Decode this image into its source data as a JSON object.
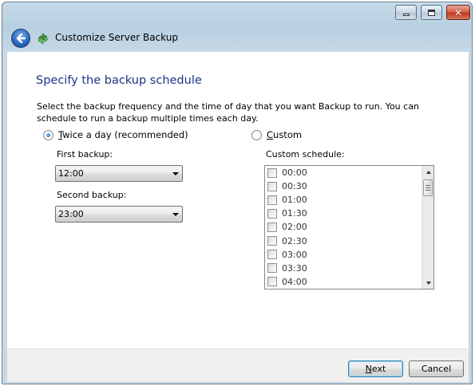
{
  "window": {
    "title": "Customize Server Backup",
    "controls": {
      "minimize_icon": "minimize-icon",
      "maximize_icon": "maximize-icon",
      "close_icon": "close-icon",
      "close_glyph": "✕"
    }
  },
  "page": {
    "heading": "Specify the backup schedule",
    "instructions": "Select the backup frequency and the time of day that you want Backup to run. You can schedule to run a backup multiple times each day."
  },
  "options": {
    "twice": {
      "accel": "T",
      "rest": "wice a day (recommended)",
      "selected": true
    },
    "custom": {
      "accel": "C",
      "rest": "ustom",
      "selected": false
    }
  },
  "first_backup": {
    "label": "First backup:",
    "value": "12:00"
  },
  "second_backup": {
    "label": "Second backup:",
    "value": "23:00"
  },
  "custom_schedule": {
    "label": "Custom schedule:",
    "times": [
      "00:00",
      "00:30",
      "01:00",
      "01:30",
      "02:00",
      "02:30",
      "03:00",
      "03:30",
      "04:00"
    ]
  },
  "footer": {
    "next": {
      "accel": "N",
      "rest": "ext"
    },
    "cancel": "Cancel"
  },
  "colors": {
    "heading": "#1e3287",
    "accent": "#3c7fb1"
  }
}
